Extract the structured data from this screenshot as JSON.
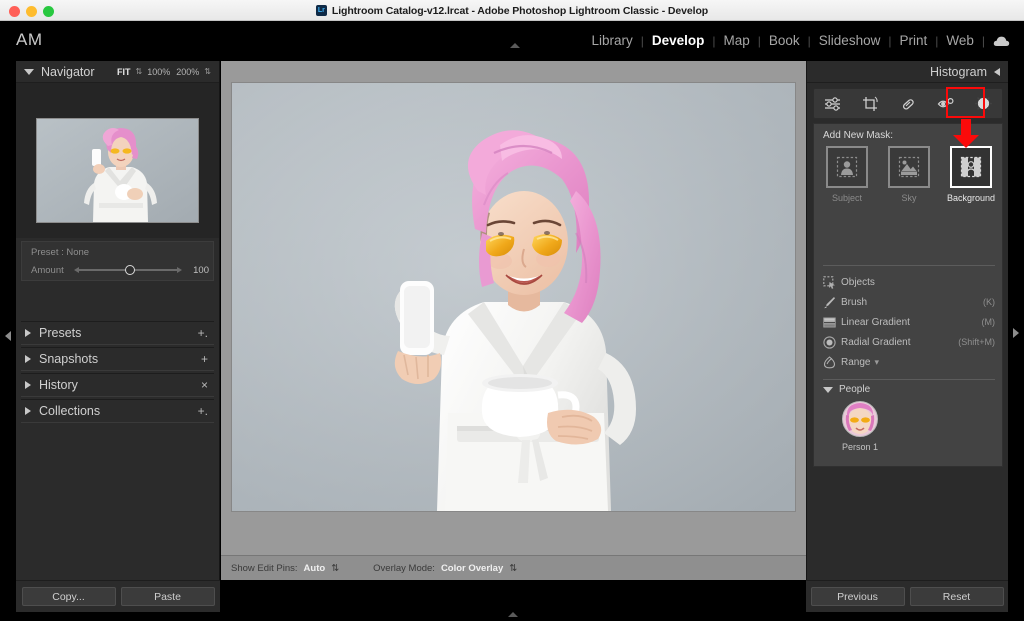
{
  "window": {
    "title": "Lightroom Catalog-v12.lrcat - Adobe Photoshop Lightroom Classic - Develop",
    "app_badge": "Lr"
  },
  "topbar": {
    "identity": "AM",
    "modules": [
      {
        "label": "Library",
        "active": false
      },
      {
        "label": "Develop",
        "active": true
      },
      {
        "label": "Map",
        "active": false
      },
      {
        "label": "Book",
        "active": false
      },
      {
        "label": "Slideshow",
        "active": false
      },
      {
        "label": "Print",
        "active": false
      },
      {
        "label": "Web",
        "active": false
      }
    ],
    "separator": "|",
    "cloud_icon": "cloud-icon"
  },
  "left_panel": {
    "navigator": {
      "title": "Navigator",
      "zoom_levels": [
        {
          "label": "FIT",
          "active": true
        },
        {
          "label": "100%",
          "active": false
        },
        {
          "label": "200%",
          "active": false
        }
      ]
    },
    "preset_box": {
      "preset_line": "Preset : None",
      "amount_label": "Amount",
      "amount_value": "100"
    },
    "sections": [
      {
        "label": "Presets",
        "action": "+."
      },
      {
        "label": "Snapshots",
        "action": "+"
      },
      {
        "label": "History",
        "action": "×"
      },
      {
        "label": "Collections",
        "action": "+."
      }
    ],
    "buttons": [
      {
        "label": "Copy..."
      },
      {
        "label": "Paste"
      }
    ]
  },
  "toolbar": {
    "show_edit_pins_label": "Show Edit Pins:",
    "show_edit_pins_value": "Auto",
    "overlay_mode_label": "Overlay Mode:",
    "overlay_mode_value": "Color Overlay"
  },
  "right_panel": {
    "histogram_title": "Histogram",
    "tools": [
      {
        "name": "edit-sliders-icon",
        "active": false
      },
      {
        "name": "crop-overlay-icon",
        "active": false
      },
      {
        "name": "healing-brush-icon",
        "active": false
      },
      {
        "name": "red-eye-icon",
        "active": false
      },
      {
        "name": "masking-icon",
        "active": true
      }
    ],
    "masking": {
      "add_new_mask_label": "Add New Mask:",
      "options": [
        {
          "label": "Subject",
          "icon": "subject-mask-icon",
          "selected": false
        },
        {
          "label": "Sky",
          "icon": "sky-mask-icon",
          "selected": false
        },
        {
          "label": "Background",
          "icon": "background-mask-icon",
          "selected": true
        }
      ],
      "tools": [
        {
          "label": "Objects",
          "icon": "objects-icon",
          "shortcut": ""
        },
        {
          "label": "Brush",
          "icon": "brush-icon",
          "shortcut": "(K)"
        },
        {
          "label": "Linear Gradient",
          "icon": "linear-gradient-icon",
          "shortcut": "(M)"
        },
        {
          "label": "Radial Gradient",
          "icon": "radial-gradient-icon",
          "shortcut": "(Shift+M)"
        },
        {
          "label": "Range",
          "icon": "range-icon",
          "shortcut": ""
        }
      ],
      "people_label": "People",
      "people": [
        {
          "label": "Person 1"
        }
      ]
    },
    "buttons": [
      {
        "label": "Previous"
      },
      {
        "label": "Reset"
      }
    ]
  },
  "annotations": {
    "highlight_color": "#fb0a0a",
    "highlight_target": "masking-icon",
    "arrow_target": "background-mask-option"
  },
  "colors": {
    "panel_bg": "#2b2b2b",
    "canvas_bg": "#9a9a9a",
    "mask_panel_bg": "#434343",
    "accent_red": "#fb0a0a",
    "text_primary": "#d0d0d0",
    "text_dim": "#8e8e8e"
  }
}
